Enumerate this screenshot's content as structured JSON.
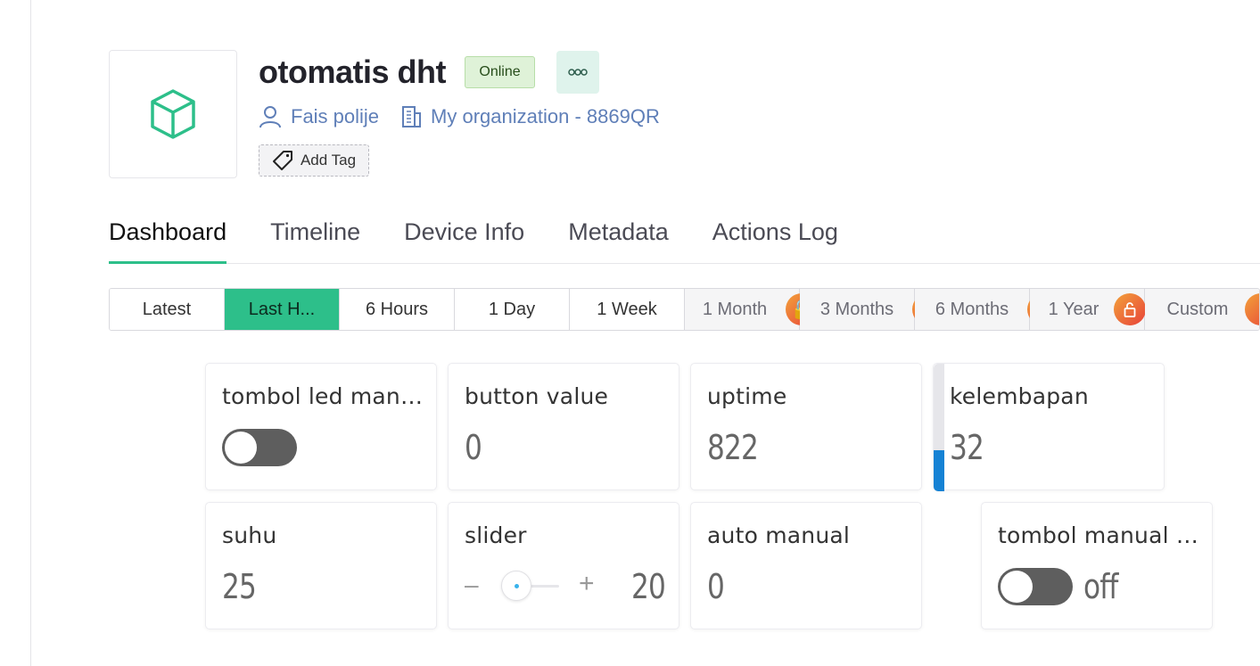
{
  "device": {
    "title": "otomatis dht",
    "status": "Online",
    "owner": "Fais polije",
    "organization": "My organization - 8869QR",
    "add_tag_label": "Add Tag"
  },
  "tabs": [
    {
      "label": "Dashboard",
      "active": true
    },
    {
      "label": "Timeline"
    },
    {
      "label": "Device Info"
    },
    {
      "label": "Metadata"
    },
    {
      "label": "Actions Log"
    }
  ],
  "time_ranges": [
    {
      "label": "Latest"
    },
    {
      "label": "Last H..."
    },
    {
      "label": "6 Hours"
    },
    {
      "label": "1 Day"
    },
    {
      "label": "1 Week"
    },
    {
      "label": "1 Month"
    },
    {
      "label": "3 Months"
    },
    {
      "label": "6 Months"
    },
    {
      "label": "1 Year"
    },
    {
      "label": "Custom"
    }
  ],
  "widgets": {
    "led_manual": {
      "title": "tombol led man…",
      "switch_on": false
    },
    "button_value": {
      "title": "button value",
      "value": "0"
    },
    "uptime": {
      "title": "uptime",
      "value": "822"
    },
    "humidity": {
      "title": "kelembapan",
      "value": "32",
      "level_percent": 32
    },
    "temperature": {
      "title": "suhu",
      "value": "25"
    },
    "slider": {
      "title": "slider",
      "minus": "–",
      "plus": "+",
      "value": "20"
    },
    "auto_manual": {
      "title": "auto manual",
      "value": "0"
    },
    "manual_switch": {
      "title": "tombol manual …",
      "state": "off",
      "switch_on": false
    }
  },
  "colors": {
    "accent": "#2dbf8a",
    "link": "#5f7fb8",
    "online_bg": "#dff2d8",
    "level_fill": "#1582d4",
    "lock_gradient_start": "#f2a23a",
    "lock_gradient_end": "#e8413a"
  }
}
